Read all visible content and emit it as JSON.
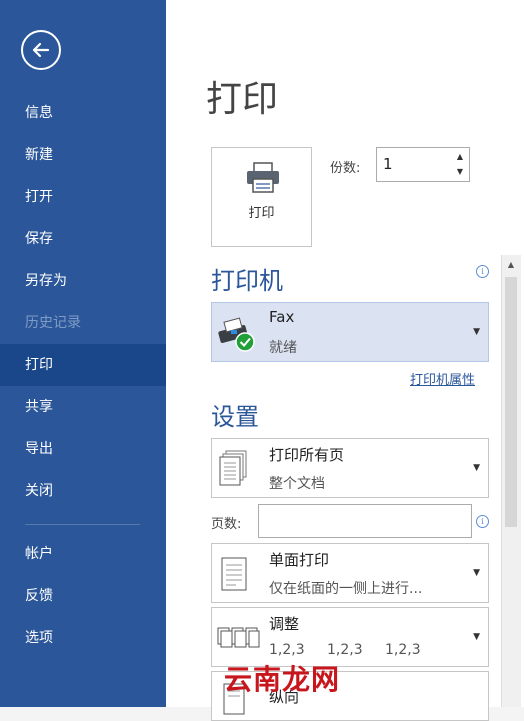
{
  "sidebar": {
    "items": [
      {
        "label": "信息"
      },
      {
        "label": "新建"
      },
      {
        "label": "打开"
      },
      {
        "label": "保存"
      },
      {
        "label": "另存为"
      },
      {
        "label": "历史记录"
      },
      {
        "label": "打印"
      },
      {
        "label": "共享"
      },
      {
        "label": "导出"
      },
      {
        "label": "关闭"
      },
      {
        "label": "帐户"
      },
      {
        "label": "反馈"
      },
      {
        "label": "选项"
      }
    ],
    "active_item": "打印",
    "disabled_item": "历史记录"
  },
  "main": {
    "title": "打印",
    "print_button_label": "打印",
    "copies_label": "份数:",
    "copies_value": "1",
    "printer_section_title": "打印机",
    "printer": {
      "name": "Fax",
      "status": "就绪"
    },
    "printer_properties_link": "打印机属性",
    "settings_section_title": "设置",
    "settings": [
      {
        "title": "打印所有页",
        "subtitle": "整个文档"
      },
      {
        "title": "单面打印",
        "subtitle": "仅在纸面的一侧上进行..."
      },
      {
        "title": "调整",
        "subtitle_parts": [
          "1,2,3",
          "1,2,3",
          "1,2,3"
        ]
      },
      {
        "title": "纵向",
        "subtitle": ""
      }
    ],
    "pages_label": "页数:",
    "pages_value": ""
  },
  "watermark": {
    "text": "云南龙网"
  },
  "colors": {
    "sidebar_bg": "#2b579a",
    "sidebar_active": "#19478a",
    "accent": "#2b579a",
    "selected_bg": "#dbe3f3",
    "ok_green": "#21a03a",
    "watermark_red": "#c8161d"
  }
}
